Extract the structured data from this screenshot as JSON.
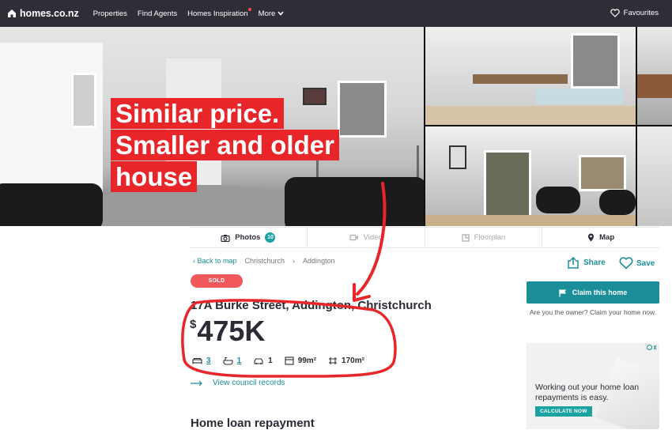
{
  "nav": {
    "logo": "homes.co.nz",
    "links": [
      "Properties",
      "Find Agents",
      "Homes Inspiration",
      "More"
    ],
    "favourites": "Favourites"
  },
  "overlay": {
    "lines": [
      "Similar price.",
      "Smaller and older",
      "house"
    ]
  },
  "tabs": {
    "photos": "Photos",
    "photos_count": "10",
    "video": "Video",
    "floorplan": "Floorplan",
    "map": "Map"
  },
  "breadcrumb": {
    "back": "Back to map",
    "city": "Christchurch",
    "suburb": "Addington"
  },
  "actions": {
    "share": "Share",
    "save": "Save"
  },
  "listing": {
    "status": "SOLD",
    "address": "17A Burke Street, Addington, Christchurch",
    "price_symbol": "$",
    "price": "475K",
    "bedrooms": "3",
    "bathrooms": "1",
    "parking": "1",
    "floor_area": "99m²",
    "land_area": "170m²",
    "council_link": "View council records"
  },
  "sections": {
    "loan_heading": "Home loan repayment"
  },
  "sidebar": {
    "claim_button": "Claim this home",
    "owner_text": "Are you the owner? Claim your home now."
  },
  "ad": {
    "text": "Working out your home loan repayments is easy.",
    "button": "CALCULATE NOW"
  },
  "colors": {
    "accent": "#1a8f9a",
    "sold": "#f0585c",
    "annotation": "#e8262a",
    "nav_bg": "#2d2e36"
  }
}
